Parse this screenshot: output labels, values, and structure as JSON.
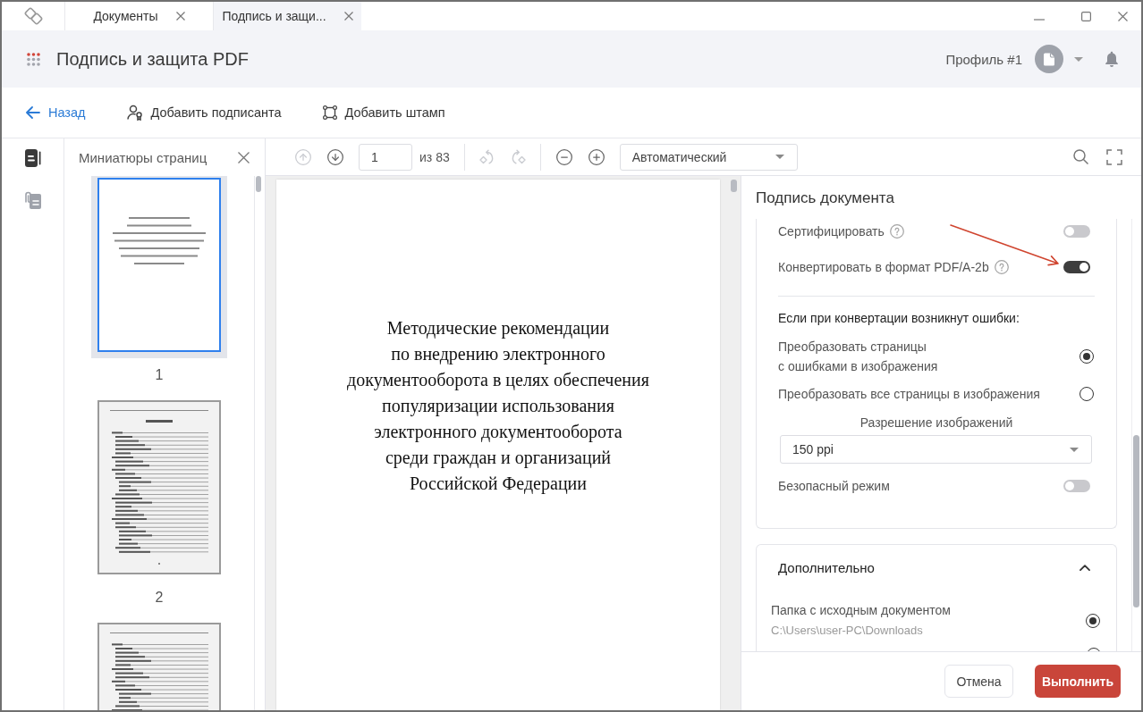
{
  "window": {
    "tabs": [
      {
        "label": "Документы",
        "selected": false
      },
      {
        "label": "Подпись и защи...",
        "selected": true
      }
    ]
  },
  "header": {
    "title": "Подпись и защита PDF",
    "profile": "Профиль #1"
  },
  "actions": {
    "back": "Назад",
    "items": [
      {
        "kind": "signer",
        "label": "Добавить подписанта"
      },
      {
        "kind": "stamp",
        "label": "Добавить штамп"
      }
    ]
  },
  "rail": [
    {
      "kind": "pages",
      "selected": true
    },
    {
      "kind": "attachments",
      "selected": false
    }
  ],
  "thumbnails": {
    "title": "Миниатюры страниц",
    "pages": [
      {
        "kind": "title",
        "label": "1",
        "selected": true
      },
      {
        "kind": "contents",
        "label": "2",
        "selected": false
      },
      {
        "kind": "text",
        "selected": false
      }
    ]
  },
  "toolbar": {
    "nav": [
      {
        "kind": "up",
        "disabled": true
      },
      {
        "kind": "down",
        "disabled": false
      }
    ],
    "page": "1",
    "page_count": "из 83",
    "rotate": [
      {
        "kind": "left",
        "disabled": true
      },
      {
        "kind": "right",
        "disabled": true
      }
    ],
    "zoom": "Автоматический"
  },
  "document": {
    "title": "Методические рекомендации\nпо внедрению электронного\nдокументооборота в целях обеспечения\nпопуляризации использования\nэлектронного документооборота\nсреди граждан и организаций\nРоссийской Федерации"
  },
  "sign_panel": {
    "title": "Подпись документа",
    "options": [
      {
        "label": "Сертифицировать",
        "help": true,
        "on": false
      },
      {
        "label": "Конвертировать в формат PDF/A-2b",
        "help": true,
        "on": true
      }
    ],
    "errors_heading": "Если при конвертации возникнут ошибки:",
    "error_modes": [
      {
        "label": "Преобразовать страницы\nс ошибками в изображения",
        "selected": true
      },
      {
        "label": "Преобразовать все страницы в изображения",
        "selected": false
      }
    ],
    "resolution_label": "Разрешение изображений",
    "resolution": "150 ppi",
    "safe_mode": {
      "label": "Безопасный режим",
      "on": false
    }
  },
  "extra": {
    "title": "Дополнительно",
    "expanded": true,
    "destinations": [
      {
        "label": "Папка с исходным документом",
        "path": "C:\\Users\\user-PC\\Downloads",
        "selected": true
      },
      {
        "selected": false
      }
    ]
  },
  "footer": {
    "cancel": "Отмена",
    "submit": "Выполнить"
  }
}
